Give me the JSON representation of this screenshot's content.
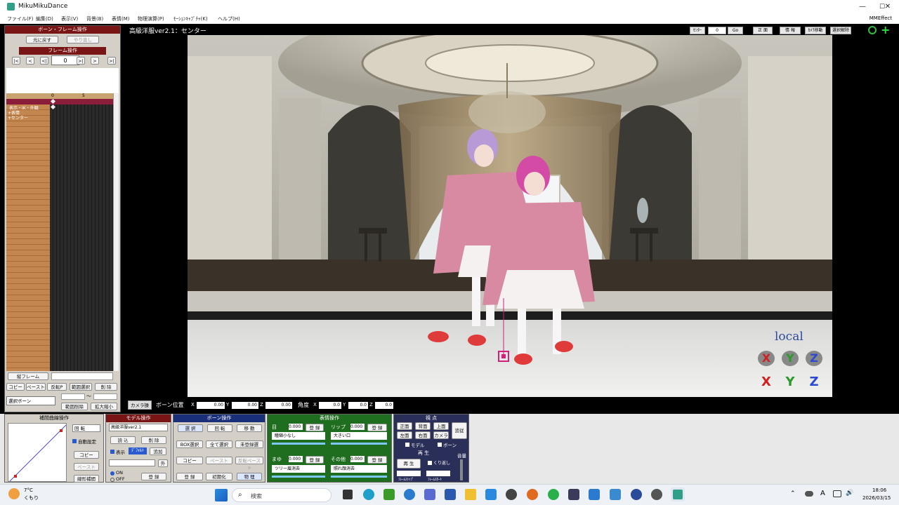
{
  "window": {
    "title": "MikuMikuDance",
    "minimize": "—",
    "maximize": "☐",
    "close": "✕"
  },
  "menu": {
    "items": [
      "ファイル(F)",
      "編集(D)",
      "表示(V)",
      "背景(B)",
      "表情(M)",
      "物理演算(P)",
      "ﾓｰｼｮﾝｷｬﾌﾟﾁｬ(K)",
      "ヘルプ(H)"
    ],
    "right": "MMEffect"
  },
  "left_panel": {
    "header": "ボーン・フレーム操作",
    "undo": "元に戻す",
    "redo": "やり直し",
    "frame_header": "フレーム操作",
    "frame_value": "0",
    "frame_buttons": [
      "|<",
      "<",
      "<|",
      ">|",
      ">",
      ">|"
    ],
    "timeline_marks": [
      "0",
      "5"
    ],
    "bone_rows": [
      "表示・IK・外観",
      "+表情",
      "+センター"
    ],
    "frame_register": "縦フレーム",
    "buttons_row1": [
      "コピー",
      "ペースト",
      "反転P",
      "範囲選択",
      "削 除"
    ],
    "select_label": "選択ボーン",
    "range_delete": "範囲削除",
    "expand": "拡大縮小",
    "tilde": "～"
  },
  "viewport": {
    "title": "高級洋服ver2.1：センター",
    "toolbar": [
      "ｾﾝﾀｰ",
      "0",
      "Go",
      "正 面",
      "情 報",
      "ｶﾒﾗ移動",
      "選択解除"
    ],
    "local_label": "local",
    "axes_top": [
      "X",
      "Y",
      "Z"
    ],
    "axes_bottom": [
      "X",
      "Y",
      "Z"
    ]
  },
  "camera_bar": {
    "camera_button": "カメラ操",
    "bone_pos_label": "ボーン位置",
    "x_label": "X",
    "x_value": "0.00",
    "y_label": "Y",
    "y_value": "0.00",
    "z_label": "Z",
    "z_value": "0.00",
    "angle_label": "角度",
    "ax_label": "X",
    "ax_value": "0.0",
    "ay_label": "Y",
    "ay_value": "0.0",
    "az_label": "Z",
    "az_value": "0.0"
  },
  "interp_panel": {
    "header": "補間曲線操作",
    "mode": "回 転",
    "auto_label": "自動設定",
    "copy": "コピー",
    "paste": "ペースト",
    "linear": "線形補間"
  },
  "model_panel": {
    "header": "モデル操作",
    "model_select": "高級洋服ver2.1",
    "load": "読 込",
    "delete": "削 除",
    "display_label": "表示",
    "select_btn": "ﾃﾞﾌｫﾙﾄ",
    "add_btn": "追加",
    "outer": "外",
    "on_label": "ON",
    "off_label": "OFF",
    "register": "登 録"
  },
  "bone_panel": {
    "header": "ボーン操作",
    "select": "選 択",
    "rotate": "回 転",
    "move": "移 動",
    "box_select": "BOX選択",
    "select_all": "全て選択",
    "unregistered": "未登録選",
    "copy": "コピー",
    "paste": "ペースト",
    "reverse_paste": "反転ペースト",
    "reset": "初期化",
    "physics": "物 理",
    "register": "登 録"
  },
  "morph_panel": {
    "header": "表情操作",
    "eye_label": "目",
    "eye_value": "0.000",
    "eye_reg": "登 録",
    "lip_label": "リップ",
    "lip_value": "0.000",
    "lip_reg": "登 録",
    "eye_select": "瞳縮小なし",
    "lip_select": "大きい口",
    "brow_label": "まゆ",
    "brow_value": "0.000",
    "brow_reg": "登 録",
    "other_label": "その他",
    "other_value": "0.000",
    "other_reg": "登 録",
    "brow_select": "ツリー眉消去",
    "other_select": "照れ顔消去"
  },
  "view_panel": {
    "header": "視 点",
    "front": "正面",
    "back": "背面",
    "top": "上面",
    "left": "左面",
    "right": "右面",
    "camera": "カメラ",
    "follow": "追従",
    "model_check": "モデル",
    "bone_check": "ボーン",
    "play_header": "再 生",
    "play": "再 生",
    "repeat": "くり返し",
    "volume_label": "音量",
    "frame_stop": "ﾌﾚｰﾑｽﾄｯﾌﾟ",
    "frame_start": "ﾌﾚｰﾑｽﾀｰﾄ"
  },
  "taskbar": {
    "weather_temp": "7°C",
    "weather_desc": "くもり",
    "search_placeholder": "検索",
    "time": "18:06",
    "date": "2026/03/15",
    "lang": "A"
  },
  "colors": {
    "panel_header": "#7a1515",
    "morph_green": "#1f6e1f",
    "bone_blue": "#1a2f7a",
    "view_blue": "#2a2f5a",
    "axis_red": "#d02020",
    "axis_green": "#2a9a2a",
    "axis_blue": "#2a4ad0",
    "local_blue": "#2d4a9a"
  }
}
